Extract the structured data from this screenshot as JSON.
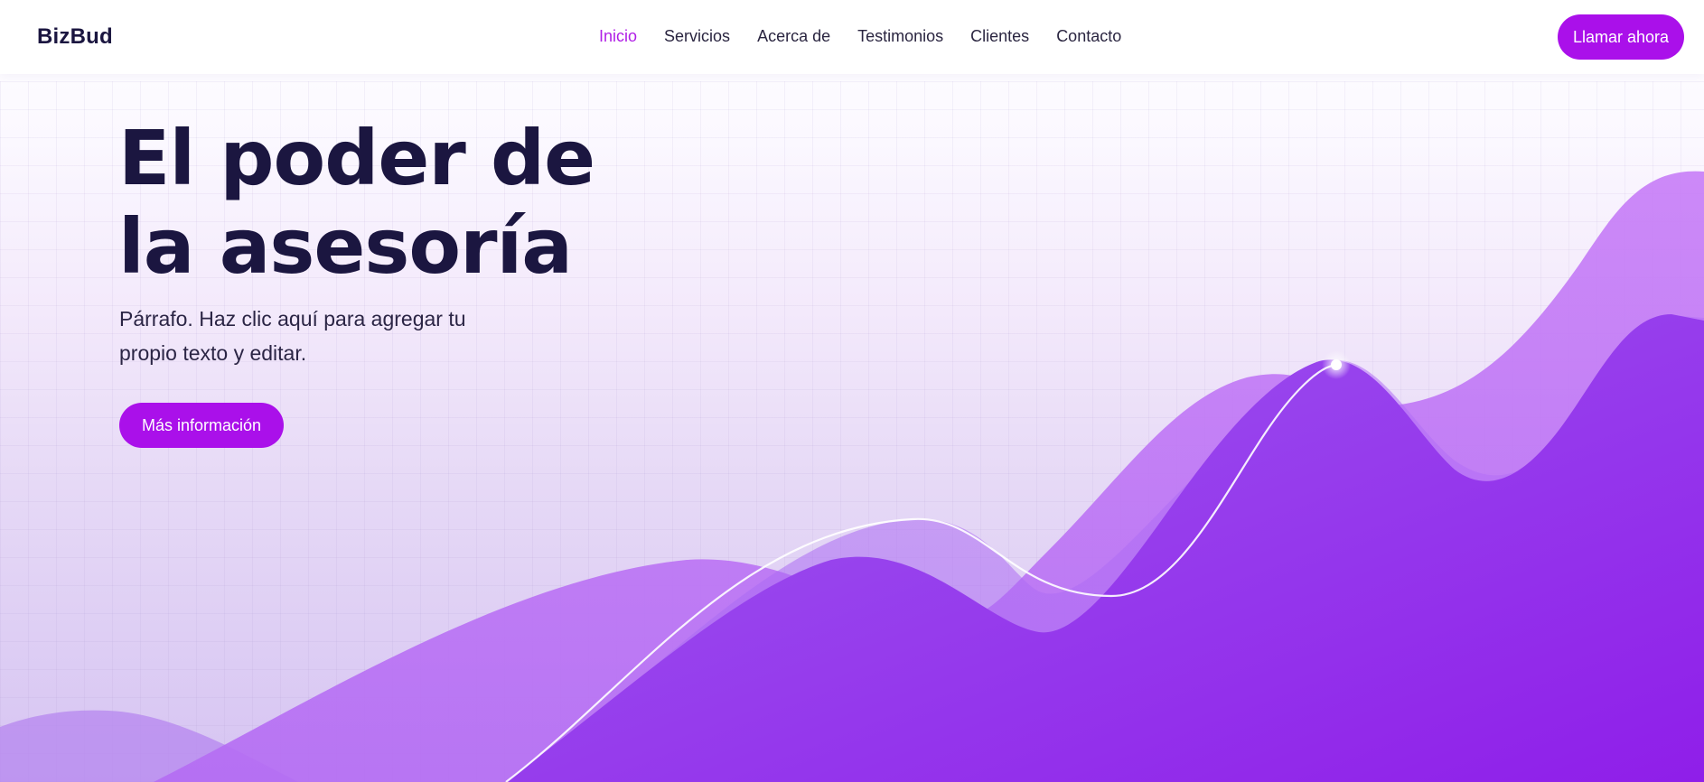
{
  "header": {
    "logo": "BizBud",
    "nav": [
      {
        "label": "Inicio",
        "active": true
      },
      {
        "label": "Servicios",
        "active": false
      },
      {
        "label": "Acerca de",
        "active": false
      },
      {
        "label": "Testimonios",
        "active": false
      },
      {
        "label": "Clientes",
        "active": false
      },
      {
        "label": "Contacto",
        "active": false
      }
    ],
    "call_button": "Llamar ahora"
  },
  "hero": {
    "title_line1": "El poder de",
    "title_line2": "la asesoría",
    "paragraph_line1": "Párrafo. Haz clic aquí para agregar tu",
    "paragraph_line2": "propio texto y editar.",
    "cta_button": "Más información"
  },
  "colors": {
    "accent": "#aa10ea",
    "active_nav": "#b01ee6",
    "text_dark": "#1b1640",
    "wave_light": "#c084f5",
    "wave_mid": "#a855f7",
    "wave_deep": "#9326ee"
  }
}
